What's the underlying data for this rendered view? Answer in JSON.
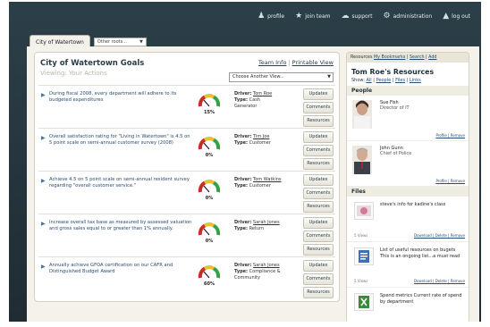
{
  "topnav": [
    {
      "icon": "profile-icon",
      "label": "profile"
    },
    {
      "icon": "join-team-icon",
      "label": "join team"
    },
    {
      "icon": "support-icon",
      "label": "support"
    },
    {
      "icon": "administration-icon",
      "label": "administration"
    },
    {
      "icon": "log-out-icon",
      "label": "log out"
    }
  ],
  "tabs": {
    "active": "City of Watertown",
    "other_select": "Other roots..."
  },
  "goals": {
    "title": "City of Watertown Goals",
    "viewing": "Viewing: Your Actions",
    "team_info": "Team Info",
    "printable_view": "Printable View",
    "view_select": "Choose Another View...",
    "items": [
      {
        "text": "During fiscal 2008, every department will adhere to its budgeted expenditures",
        "percent": "15%",
        "driver": "Tom Roe",
        "type": "Cash Generator"
      },
      {
        "text": "Overall satisfaction rating for \"Living in Watertown\" is 4.5 on 5 point scale on semi-annual customer survey (2008)",
        "percent": "0%",
        "driver": "Tim Joe",
        "type": "Customer"
      },
      {
        "text": "Achieve 4.5 on 5 point scale on semi-annual resident survey regarding \"overall customer service.\"",
        "percent": "0%",
        "driver": "Tom Watkins",
        "type": "Customer"
      },
      {
        "text": "Increase overall tax base as measured by assessed valuation and gross sales equal to or greater than 1% annually.",
        "percent": "0%",
        "driver": "Sarah Jones",
        "type": "Return"
      },
      {
        "text": "Annually achieve GFOA certification on our CAFR and Distinguished Budget Award",
        "percent": "60%",
        "driver": "Sarah Jones",
        "type": "Compliance & Community"
      }
    ],
    "driver_label": "Driver:",
    "type_label": "Type:",
    "btn_updates": "Updates",
    "btn_comments": "Comments",
    "btn_resources": "Resources"
  },
  "resources": {
    "tab_label": "Resources",
    "tab_bookmarks": "My Bookmarks",
    "tab_search": "Search",
    "tab_add": "Add",
    "title": "Tom Roe's Resources",
    "show_label": "Show:",
    "show_all": "All",
    "show_people": "People",
    "show_files": "Files",
    "show_links": "Links",
    "people_heading": "People",
    "people": [
      {
        "name": "Sue Fish",
        "role": "Director of IT",
        "links": "Profile | Remove"
      },
      {
        "name": "John Gunn",
        "role": "Chief of Police",
        "links": "Profile | Remove"
      }
    ],
    "files_heading": "Files",
    "files": [
      {
        "title": "steve's info for kadine's class",
        "count": "5 Views",
        "links": "Download | Delete | Remove",
        "icon": "image-file-icon"
      },
      {
        "title": "List of useful resources on bugets This is an ongoing list...a must read",
        "count": "5 Views",
        "links": "Download | Delete | Remove",
        "icon": "document-file-icon"
      },
      {
        "title": "Spend metrics Current rate of spend by department",
        "count": "",
        "links": "",
        "icon": "spreadsheet-file-icon"
      }
    ]
  }
}
